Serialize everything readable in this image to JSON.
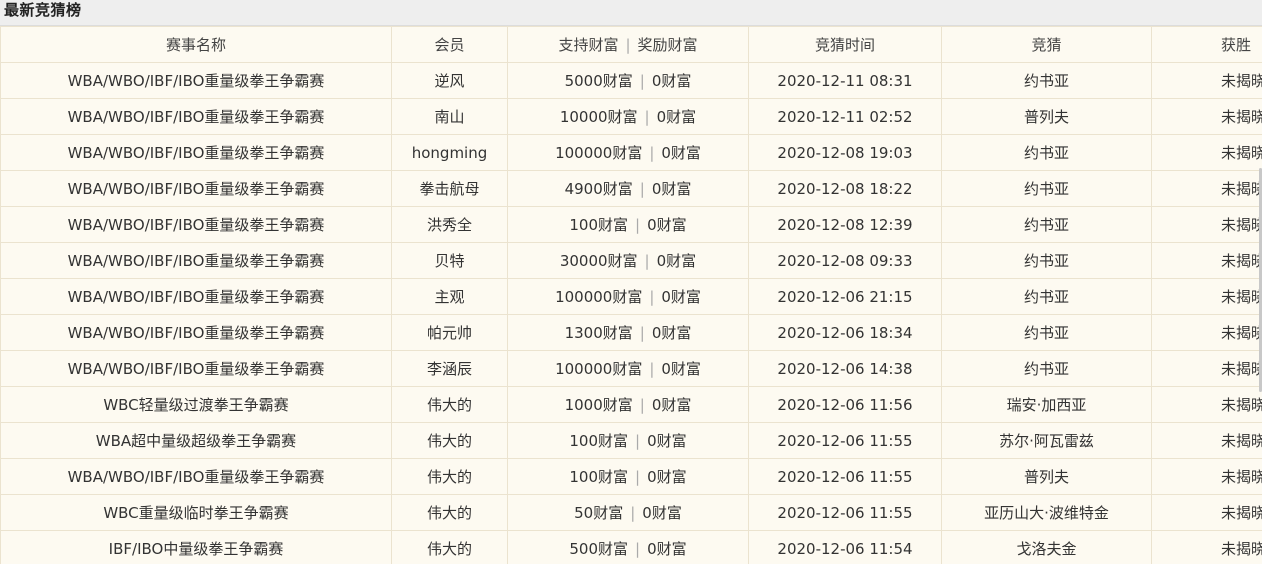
{
  "header": {
    "title": "最新竞猜榜"
  },
  "columns": {
    "event": "赛事名称",
    "member": "会员",
    "support": "支持财富",
    "reward": "奖励财富",
    "time": "竞猜时间",
    "guess": "竞猜",
    "winner": "获胜"
  },
  "rows": [
    {
      "event": "WBA/WBO/IBF/IBO重量级拳王争霸赛",
      "member": "逆风",
      "support": "5000财富",
      "reward": "0财富",
      "time": "2020-12-11 08:31",
      "guess": "约书亚",
      "winner": "未揭晓"
    },
    {
      "event": "WBA/WBO/IBF/IBO重量级拳王争霸赛",
      "member": "南山",
      "support": "10000财富",
      "reward": "0财富",
      "time": "2020-12-11 02:52",
      "guess": "普列夫",
      "winner": "未揭晓"
    },
    {
      "event": "WBA/WBO/IBF/IBO重量级拳王争霸赛",
      "member": "hongming",
      "support": "100000财富",
      "reward": "0财富",
      "time": "2020-12-08 19:03",
      "guess": "约书亚",
      "winner": "未揭晓"
    },
    {
      "event": "WBA/WBO/IBF/IBO重量级拳王争霸赛",
      "member": "拳击航母",
      "support": "4900财富",
      "reward": "0财富",
      "time": "2020-12-08 18:22",
      "guess": "约书亚",
      "winner": "未揭晓"
    },
    {
      "event": "WBA/WBO/IBF/IBO重量级拳王争霸赛",
      "member": "洪秀全",
      "support": "100财富",
      "reward": "0财富",
      "time": "2020-12-08 12:39",
      "guess": "约书亚",
      "winner": "未揭晓"
    },
    {
      "event": "WBA/WBO/IBF/IBO重量级拳王争霸赛",
      "member": "贝特",
      "support": "30000财富",
      "reward": "0财富",
      "time": "2020-12-08 09:33",
      "guess": "约书亚",
      "winner": "未揭晓"
    },
    {
      "event": "WBA/WBO/IBF/IBO重量级拳王争霸赛",
      "member": "主观",
      "support": "100000财富",
      "reward": "0财富",
      "time": "2020-12-06 21:15",
      "guess": "约书亚",
      "winner": "未揭晓"
    },
    {
      "event": "WBA/WBO/IBF/IBO重量级拳王争霸赛",
      "member": "帕元帅",
      "support": "1300财富",
      "reward": "0财富",
      "time": "2020-12-06 18:34",
      "guess": "约书亚",
      "winner": "未揭晓"
    },
    {
      "event": "WBA/WBO/IBF/IBO重量级拳王争霸赛",
      "member": "李涵辰",
      "support": "100000财富",
      "reward": "0财富",
      "time": "2020-12-06 14:38",
      "guess": "约书亚",
      "winner": "未揭晓"
    },
    {
      "event": "WBC轻量级过渡拳王争霸赛",
      "member": "伟大的",
      "support": "1000财富",
      "reward": "0财富",
      "time": "2020-12-06 11:56",
      "guess": "瑞安·加西亚",
      "winner": "未揭晓"
    },
    {
      "event": "WBA超中量级超级拳王争霸赛",
      "member": "伟大的",
      "support": "100财富",
      "reward": "0财富",
      "time": "2020-12-06 11:55",
      "guess": "苏尔·阿瓦雷兹",
      "winner": "未揭晓"
    },
    {
      "event": "WBA/WBO/IBF/IBO重量级拳王争霸赛",
      "member": "伟大的",
      "support": "100财富",
      "reward": "0财富",
      "time": "2020-12-06 11:55",
      "guess": "普列夫",
      "winner": "未揭晓"
    },
    {
      "event": "WBC重量级临时拳王争霸赛",
      "member": "伟大的",
      "support": "50财富",
      "reward": "0财富",
      "time": "2020-12-06 11:55",
      "guess": "亚历山大·波维特金",
      "winner": "未揭晓"
    },
    {
      "event": "IBF/IBO中量级拳王争霸赛",
      "member": "伟大的",
      "support": "500财富",
      "reward": "0财富",
      "time": "2020-12-06 11:54",
      "guess": "戈洛夫金",
      "winner": "未揭晓"
    }
  ]
}
